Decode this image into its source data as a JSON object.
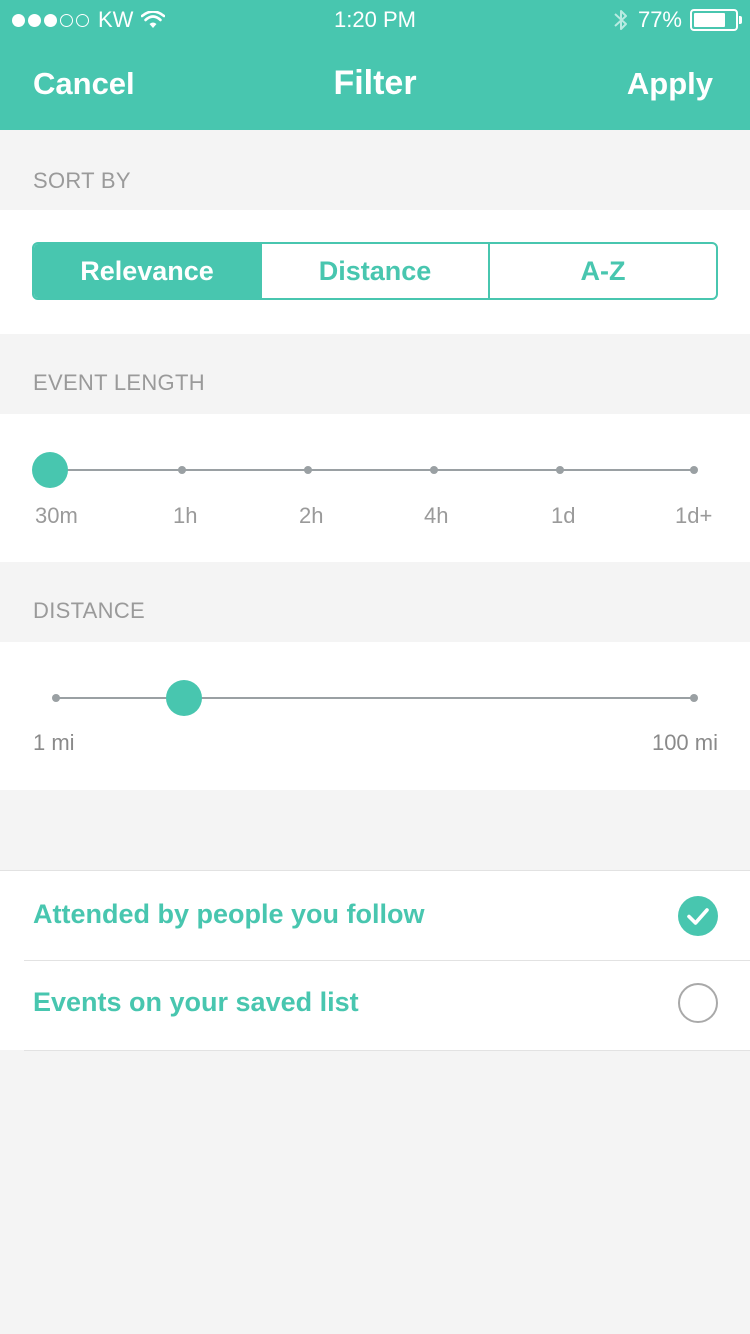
{
  "status_bar": {
    "carrier": "KW",
    "time": "1:20 PM",
    "battery": "77%",
    "battery_level": 0.77,
    "signal_bars_filled": 3,
    "signal_bars_total": 5
  },
  "nav": {
    "cancel": "Cancel",
    "title": "Filter",
    "apply": "Apply"
  },
  "sort_by": {
    "label": "SORT BY",
    "options": [
      "Relevance",
      "Distance",
      "A-Z"
    ],
    "selected": "Relevance"
  },
  "event_length": {
    "label": "EVENT LENGTH",
    "ticks": [
      "30m",
      "1h",
      "2h",
      "4h",
      "1d",
      "1d+"
    ],
    "selected": "30m"
  },
  "distance": {
    "label": "DISTANCE",
    "min_label": "1 mi",
    "max_label": "100 mi",
    "value_fraction": 0.2
  },
  "toggles": [
    {
      "label": "Attended by people you follow",
      "checked": true
    },
    {
      "label": "Events on your saved list",
      "checked": false
    }
  ],
  "colors": {
    "accent": "#48c6af",
    "background": "#f4f4f4",
    "label_gray": "#9a9a9a"
  }
}
